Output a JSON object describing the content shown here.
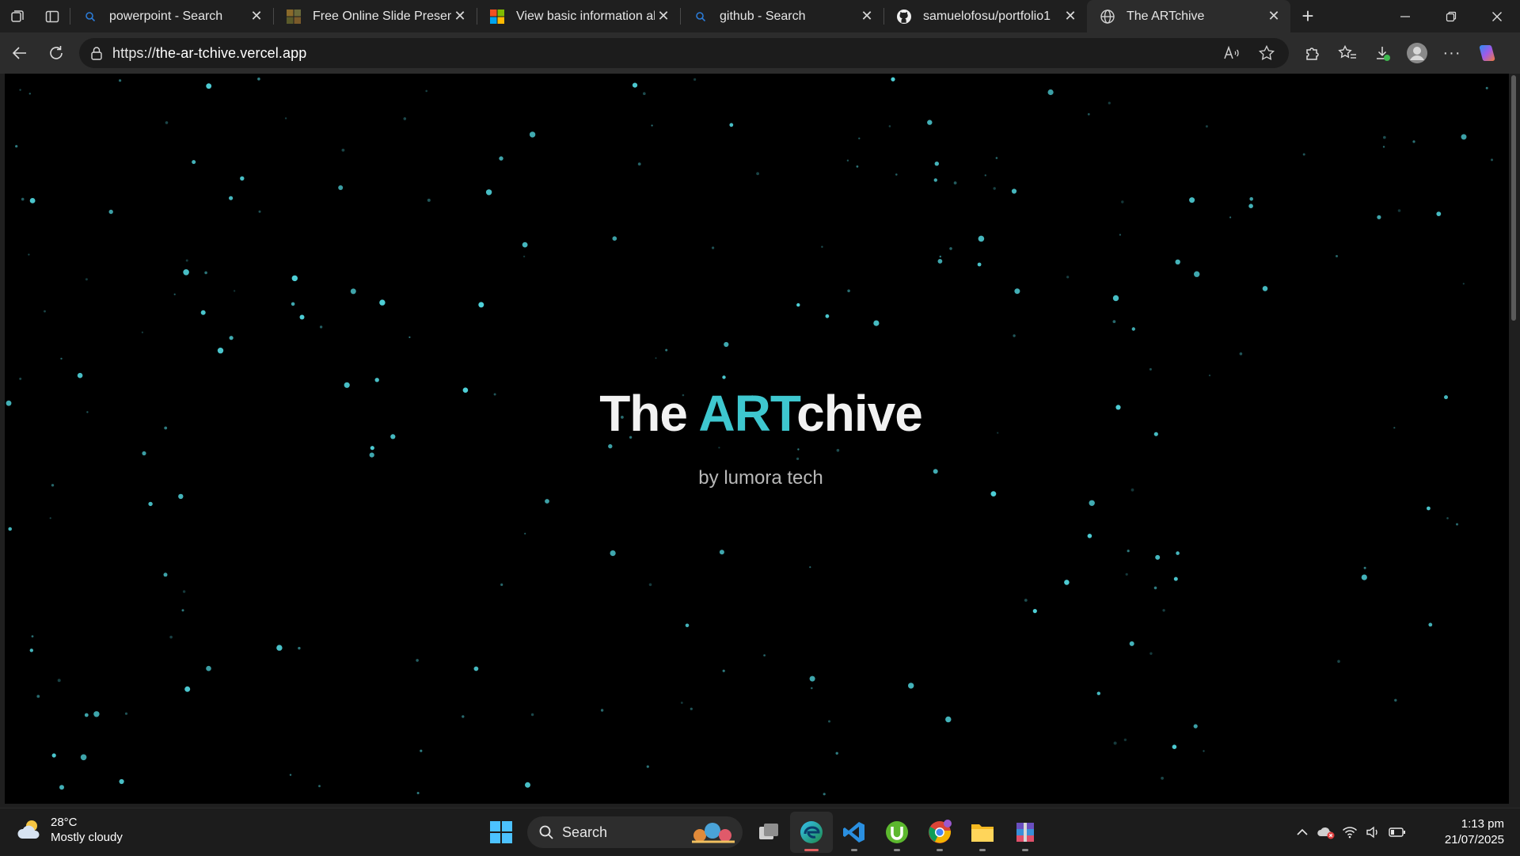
{
  "browser": {
    "tabs": [
      {
        "title": "powerpoint - Search",
        "favicon": "bing-search-icon"
      },
      {
        "title": "Free Online Slide Presentat",
        "favicon": "slides-icon"
      },
      {
        "title": "View basic information abo",
        "favicon": "microsoft-icon"
      },
      {
        "title": "github - Search",
        "favicon": "bing-search-icon"
      },
      {
        "title": "samuelofosu/portfolio1",
        "favicon": "github-icon"
      },
      {
        "title": "The ARTchive",
        "favicon": "globe-icon",
        "active": true
      }
    ],
    "address": {
      "scheme": "https://",
      "host": "the-ar-tchive.vercel.app"
    }
  },
  "page": {
    "title_prefix": "The ",
    "title_accent": "ART",
    "title_suffix": "chive",
    "subtitle": "by lumora tech",
    "accent_color": "#3ec7cf",
    "star_color": "#4fd1d9"
  },
  "taskbar": {
    "weather": {
      "temp": "28°C",
      "condition": "Mostly cloudy"
    },
    "search_label": "Search",
    "clock": {
      "time": "1:13 pm",
      "date": "21/07/2025"
    }
  }
}
